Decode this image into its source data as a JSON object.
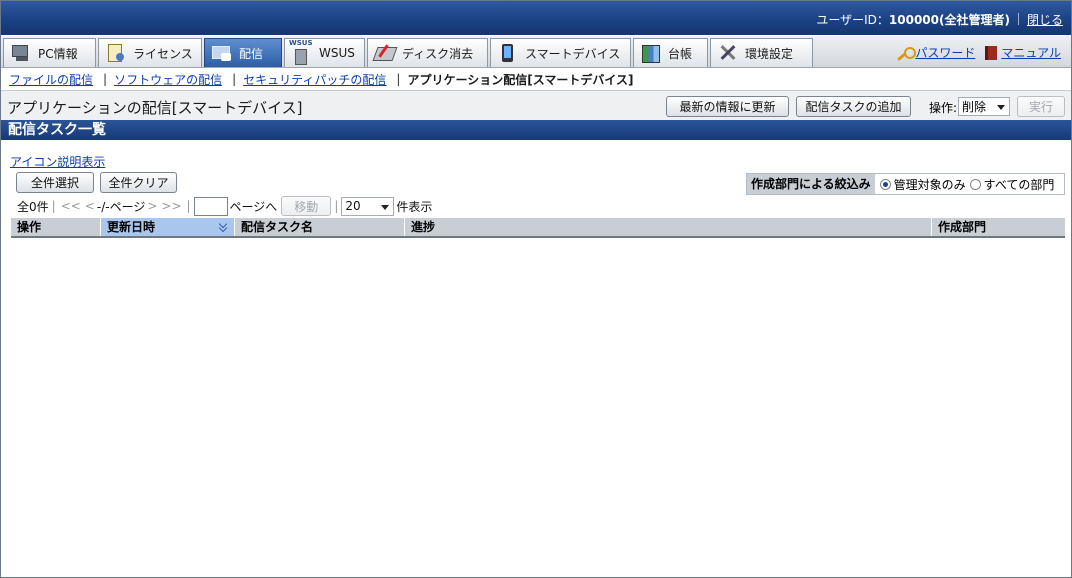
{
  "header": {
    "user_label": "ユーザーID：",
    "user_value": "100000(全社管理者)",
    "logout": "閉じる"
  },
  "tabs": [
    {
      "label": "PC情報",
      "icon": "pc-icon"
    },
    {
      "label": "ライセンス",
      "icon": "license-icon"
    },
    {
      "label": "配信",
      "icon": "distribution-icon",
      "active": true
    },
    {
      "label": "WSUS",
      "icon": "wsus-icon"
    },
    {
      "label": "ディスク消去",
      "icon": "disk-erase-icon"
    },
    {
      "label": "スマートデバイス",
      "icon": "smart-device-icon"
    },
    {
      "label": "台帳",
      "icon": "ledger-icon"
    },
    {
      "label": "環境設定",
      "icon": "settings-icon"
    }
  ],
  "toplinks": {
    "password": "パスワード",
    "manual": "マニュアル"
  },
  "subnav": {
    "file": "ファイルの配信",
    "software": "ソフトウェアの配信",
    "security": "セキュリティパッチの配信",
    "current": "アプリケーション配信[スマートデバイス]"
  },
  "page": {
    "title": "アプリケーションの配信[スマートデバイス]",
    "refresh_button": "最新の情報に更新",
    "add_task_button": "配信タスクの追加",
    "operation_label": "操作:",
    "operation_value": "削除",
    "execute_button": "実行"
  },
  "section": {
    "title": "配信タスク一覧"
  },
  "list": {
    "icon_legend": "アイコン説明表示",
    "select_all": "全件選択",
    "clear_all": "全件クリア",
    "filter_label": "作成部門による絞込み",
    "filter_option_managed": "管理対象のみ",
    "filter_option_all": "すべての部門",
    "total": "全0件",
    "first": "<<",
    "prev": "<",
    "page_status": "-/-ページ",
    "next": ">",
    "last": ">>",
    "goto_label": "ページへ",
    "move_button": "移動",
    "per_page_value": "20",
    "per_page_label": "件表示"
  },
  "table": {
    "columns": [
      "操作",
      "更新日時",
      "配信タスク名",
      "進捗",
      "作成部門"
    ],
    "rows": []
  },
  "colors": {
    "header_blue": "#1d4486",
    "active_tab": "#2d5ea6",
    "link": "#0b3ea8",
    "table_header": "#c9ced5",
    "sorted_header": "#a9c6ef"
  }
}
